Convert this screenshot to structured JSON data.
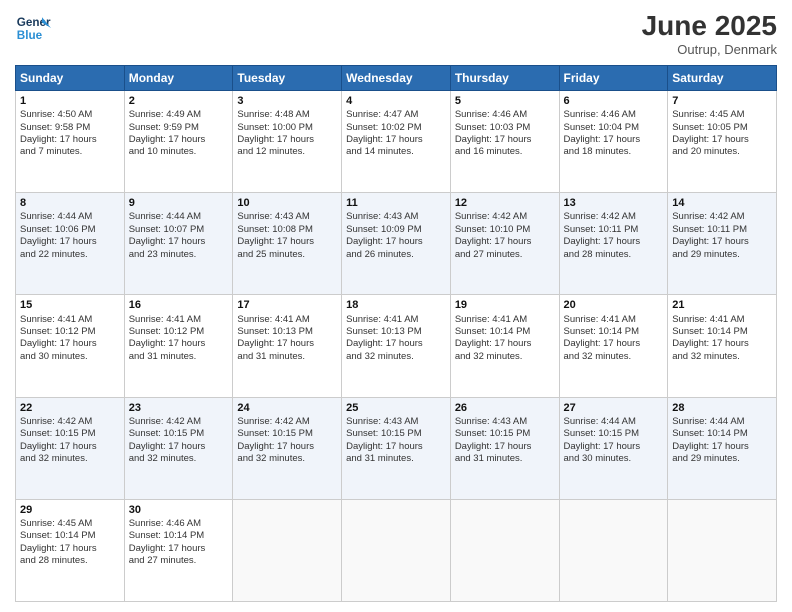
{
  "header": {
    "logo_line1": "General",
    "logo_line2": "Blue",
    "month_year": "June 2025",
    "location": "Outrup, Denmark"
  },
  "weekdays": [
    "Sunday",
    "Monday",
    "Tuesday",
    "Wednesday",
    "Thursday",
    "Friday",
    "Saturday"
  ],
  "weeks": [
    [
      {
        "day": "1",
        "lines": [
          "Sunrise: 4:50 AM",
          "Sunset: 9:58 PM",
          "Daylight: 17 hours",
          "and 7 minutes."
        ]
      },
      {
        "day": "2",
        "lines": [
          "Sunrise: 4:49 AM",
          "Sunset: 9:59 PM",
          "Daylight: 17 hours",
          "and 10 minutes."
        ]
      },
      {
        "day": "3",
        "lines": [
          "Sunrise: 4:48 AM",
          "Sunset: 10:00 PM",
          "Daylight: 17 hours",
          "and 12 minutes."
        ]
      },
      {
        "day": "4",
        "lines": [
          "Sunrise: 4:47 AM",
          "Sunset: 10:02 PM",
          "Daylight: 17 hours",
          "and 14 minutes."
        ]
      },
      {
        "day": "5",
        "lines": [
          "Sunrise: 4:46 AM",
          "Sunset: 10:03 PM",
          "Daylight: 17 hours",
          "and 16 minutes."
        ]
      },
      {
        "day": "6",
        "lines": [
          "Sunrise: 4:46 AM",
          "Sunset: 10:04 PM",
          "Daylight: 17 hours",
          "and 18 minutes."
        ]
      },
      {
        "day": "7",
        "lines": [
          "Sunrise: 4:45 AM",
          "Sunset: 10:05 PM",
          "Daylight: 17 hours",
          "and 20 minutes."
        ]
      }
    ],
    [
      {
        "day": "8",
        "lines": [
          "Sunrise: 4:44 AM",
          "Sunset: 10:06 PM",
          "Daylight: 17 hours",
          "and 22 minutes."
        ]
      },
      {
        "day": "9",
        "lines": [
          "Sunrise: 4:44 AM",
          "Sunset: 10:07 PM",
          "Daylight: 17 hours",
          "and 23 minutes."
        ]
      },
      {
        "day": "10",
        "lines": [
          "Sunrise: 4:43 AM",
          "Sunset: 10:08 PM",
          "Daylight: 17 hours",
          "and 25 minutes."
        ]
      },
      {
        "day": "11",
        "lines": [
          "Sunrise: 4:43 AM",
          "Sunset: 10:09 PM",
          "Daylight: 17 hours",
          "and 26 minutes."
        ]
      },
      {
        "day": "12",
        "lines": [
          "Sunrise: 4:42 AM",
          "Sunset: 10:10 PM",
          "Daylight: 17 hours",
          "and 27 minutes."
        ]
      },
      {
        "day": "13",
        "lines": [
          "Sunrise: 4:42 AM",
          "Sunset: 10:11 PM",
          "Daylight: 17 hours",
          "and 28 minutes."
        ]
      },
      {
        "day": "14",
        "lines": [
          "Sunrise: 4:42 AM",
          "Sunset: 10:11 PM",
          "Daylight: 17 hours",
          "and 29 minutes."
        ]
      }
    ],
    [
      {
        "day": "15",
        "lines": [
          "Sunrise: 4:41 AM",
          "Sunset: 10:12 PM",
          "Daylight: 17 hours",
          "and 30 minutes."
        ]
      },
      {
        "day": "16",
        "lines": [
          "Sunrise: 4:41 AM",
          "Sunset: 10:12 PM",
          "Daylight: 17 hours",
          "and 31 minutes."
        ]
      },
      {
        "day": "17",
        "lines": [
          "Sunrise: 4:41 AM",
          "Sunset: 10:13 PM",
          "Daylight: 17 hours",
          "and 31 minutes."
        ]
      },
      {
        "day": "18",
        "lines": [
          "Sunrise: 4:41 AM",
          "Sunset: 10:13 PM",
          "Daylight: 17 hours",
          "and 32 minutes."
        ]
      },
      {
        "day": "19",
        "lines": [
          "Sunrise: 4:41 AM",
          "Sunset: 10:14 PM",
          "Daylight: 17 hours",
          "and 32 minutes."
        ]
      },
      {
        "day": "20",
        "lines": [
          "Sunrise: 4:41 AM",
          "Sunset: 10:14 PM",
          "Daylight: 17 hours",
          "and 32 minutes."
        ]
      },
      {
        "day": "21",
        "lines": [
          "Sunrise: 4:41 AM",
          "Sunset: 10:14 PM",
          "Daylight: 17 hours",
          "and 32 minutes."
        ]
      }
    ],
    [
      {
        "day": "22",
        "lines": [
          "Sunrise: 4:42 AM",
          "Sunset: 10:15 PM",
          "Daylight: 17 hours",
          "and 32 minutes."
        ]
      },
      {
        "day": "23",
        "lines": [
          "Sunrise: 4:42 AM",
          "Sunset: 10:15 PM",
          "Daylight: 17 hours",
          "and 32 minutes."
        ]
      },
      {
        "day": "24",
        "lines": [
          "Sunrise: 4:42 AM",
          "Sunset: 10:15 PM",
          "Daylight: 17 hours",
          "and 32 minutes."
        ]
      },
      {
        "day": "25",
        "lines": [
          "Sunrise: 4:43 AM",
          "Sunset: 10:15 PM",
          "Daylight: 17 hours",
          "and 31 minutes."
        ]
      },
      {
        "day": "26",
        "lines": [
          "Sunrise: 4:43 AM",
          "Sunset: 10:15 PM",
          "Daylight: 17 hours",
          "and 31 minutes."
        ]
      },
      {
        "day": "27",
        "lines": [
          "Sunrise: 4:44 AM",
          "Sunset: 10:15 PM",
          "Daylight: 17 hours",
          "and 30 minutes."
        ]
      },
      {
        "day": "28",
        "lines": [
          "Sunrise: 4:44 AM",
          "Sunset: 10:14 PM",
          "Daylight: 17 hours",
          "and 29 minutes."
        ]
      }
    ],
    [
      {
        "day": "29",
        "lines": [
          "Sunrise: 4:45 AM",
          "Sunset: 10:14 PM",
          "Daylight: 17 hours",
          "and 28 minutes."
        ]
      },
      {
        "day": "30",
        "lines": [
          "Sunrise: 4:46 AM",
          "Sunset: 10:14 PM",
          "Daylight: 17 hours",
          "and 27 minutes."
        ]
      },
      {
        "day": "",
        "lines": []
      },
      {
        "day": "",
        "lines": []
      },
      {
        "day": "",
        "lines": []
      },
      {
        "day": "",
        "lines": []
      },
      {
        "day": "",
        "lines": []
      }
    ]
  ]
}
